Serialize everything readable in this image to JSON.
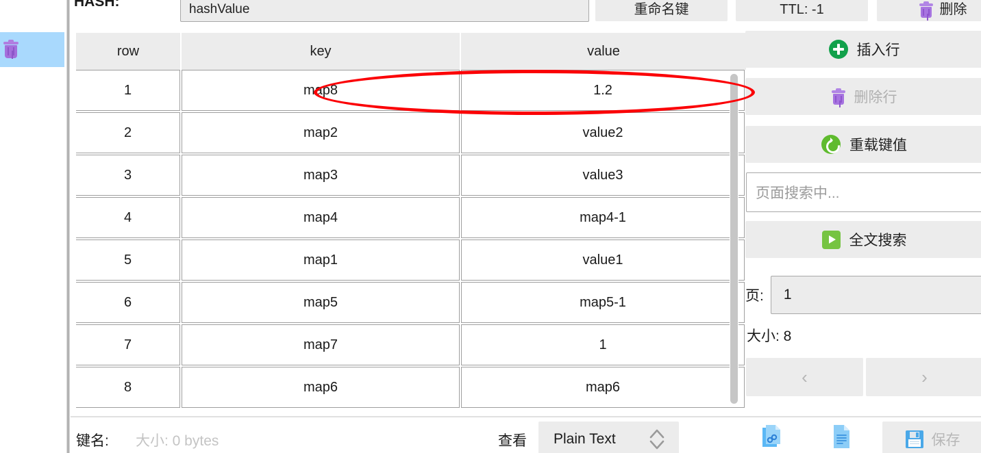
{
  "left_rail": {
    "items": [
      {
        "name": "trash-icon",
        "selected": true
      }
    ]
  },
  "topbar": {
    "hash_label": "HASH:",
    "hash_value": "hashValue",
    "rename_label": "重命名键",
    "ttl_label": "TTL: -1",
    "delete_label": "删除"
  },
  "table": {
    "columns": [
      "row",
      "key",
      "value"
    ],
    "rows": [
      {
        "row": "1",
        "key": "map8",
        "value": "1.2"
      },
      {
        "row": "2",
        "key": "map2",
        "value": "value2"
      },
      {
        "row": "3",
        "key": "map3",
        "value": "value3"
      },
      {
        "row": "4",
        "key": "map4",
        "value": "map4-1"
      },
      {
        "row": "5",
        "key": "map1",
        "value": "value1"
      },
      {
        "row": "6",
        "key": "map5",
        "value": "map5-1"
      },
      {
        "row": "7",
        "key": "map7",
        "value": "1"
      },
      {
        "row": "8",
        "key": "map6",
        "value": "map6"
      }
    ]
  },
  "annotation": {
    "type": "ellipse",
    "color": "#fb0005",
    "target": "row-1-key-and-value"
  },
  "right_panel": {
    "insert_row_label": "插入行",
    "delete_row_label": "删除行",
    "reload_label": "重载键值",
    "search_placeholder": "页面搜索中...",
    "full_search_label": "全文搜索",
    "page_label": "页:",
    "page_value": "1",
    "size_label": "大小: 8",
    "prev_label": "‹",
    "next_label": "›"
  },
  "bottombar": {
    "keyname_label": "键名:",
    "size_text": "大小: 0 bytes",
    "view_label": "查看",
    "view_format": "Plain Text",
    "save_label": "保存"
  },
  "colors": {
    "accent_green": "#12a14b",
    "light_green": "#76c442",
    "purple": "#a774e0",
    "blue_selected": "#a9d9fd",
    "annotation_red": "#fb0005",
    "icon_blue": "#4aa8e8"
  }
}
